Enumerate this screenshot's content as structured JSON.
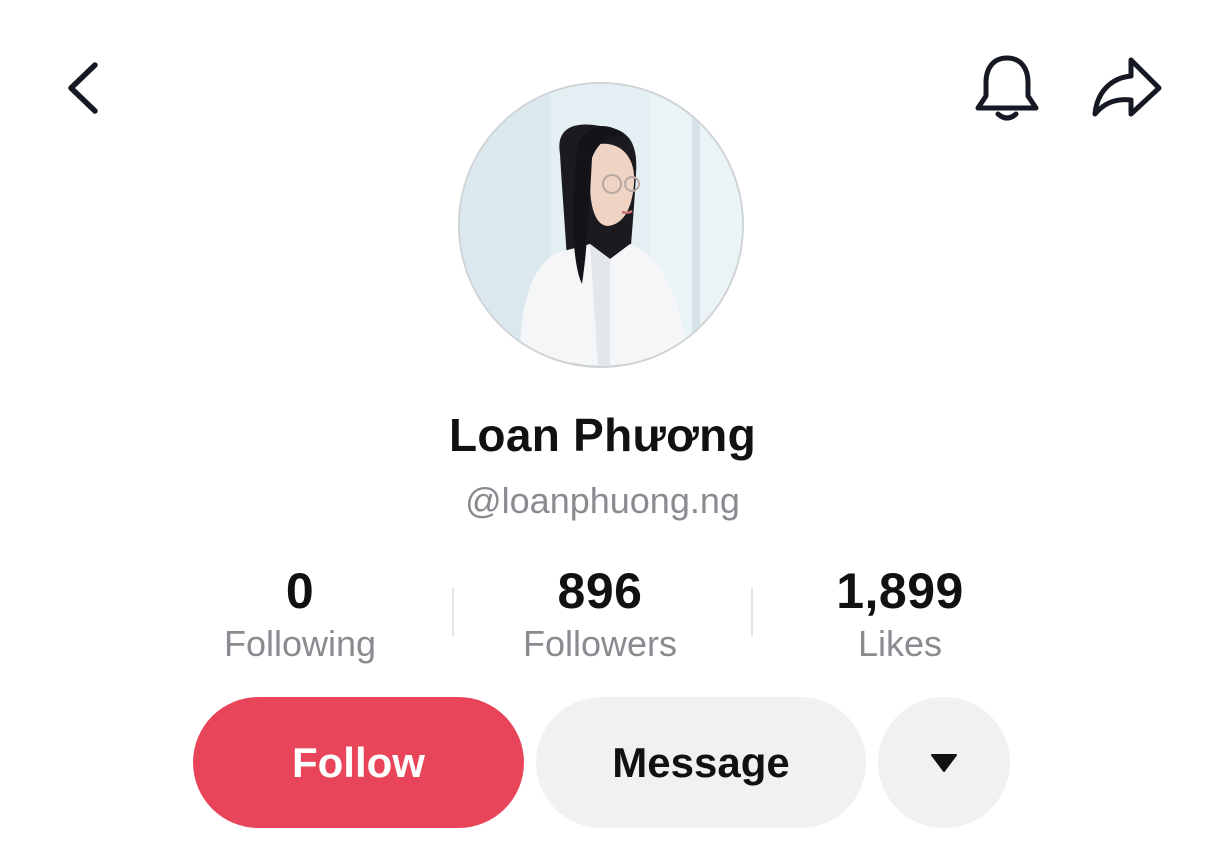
{
  "header": {
    "back_icon": "chevron-left-icon",
    "notification_icon": "bell-icon",
    "share_icon": "share-arrow-icon"
  },
  "profile": {
    "display_name": "Loan Phương",
    "username": "@loanphuong.ng",
    "avatar_icon": "profile-photo"
  },
  "stats": [
    {
      "value": "0",
      "label": "Following"
    },
    {
      "value": "896",
      "label": "Followers"
    },
    {
      "value": "1,899",
      "label": "Likes"
    }
  ],
  "actions": {
    "follow_label": "Follow",
    "message_label": "Message",
    "more_icon": "caret-down-icon"
  },
  "colors": {
    "follow_button": "#e8445a",
    "secondary_button": "#f1f1f2",
    "muted_text": "#8a8b91",
    "primary_text": "#111111"
  }
}
